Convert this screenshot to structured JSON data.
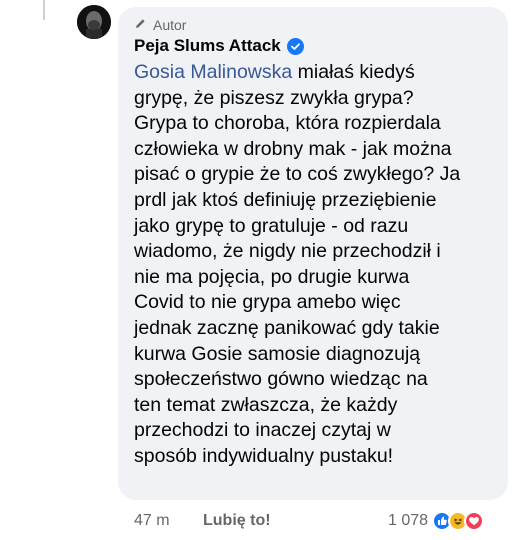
{
  "comment": {
    "author_tag": "Autor",
    "author_name": "Peja Slums Attack",
    "mention": "Gosia Malinowska",
    "lines": [
      " miałaś kiedyś",
      "grypę, że piszesz zwykła grypa?",
      "Grypa to choroba, która rozpierdala",
      "człowieka w drobny mak - jak można",
      "pisać o grypie że to coś zwykłego? Ja",
      "prdl jak ktoś definiuję przeziębienie",
      "jako grypę to gratuluje - od razu",
      "wiadomo, że nigdy nie przechodził i",
      "nie ma pojęcia, po drugie kurwa",
      "Covid to nie grypa amebo więc",
      "jednak zacznę panikować gdy takie",
      "kurwa Gosie samosie diagnozują",
      "społeczeństwo gówno wiedząc na",
      "ten temat zwłaszcza, że każdy",
      "przechodzi to inaczej czytaj w",
      "sposób indywidualny pustaku!"
    ]
  },
  "footer": {
    "time": "47 m",
    "like_label": "Lubię to!",
    "reaction_count": "1 078"
  },
  "colors": {
    "bubble": "#f0f2f5",
    "mention": "#385898",
    "verified": "#1877f2",
    "muted": "#65676b"
  },
  "icons": [
    "pen-icon",
    "verified-badge-icon",
    "like-reaction-icon",
    "haha-reaction-icon",
    "love-reaction-icon"
  ]
}
